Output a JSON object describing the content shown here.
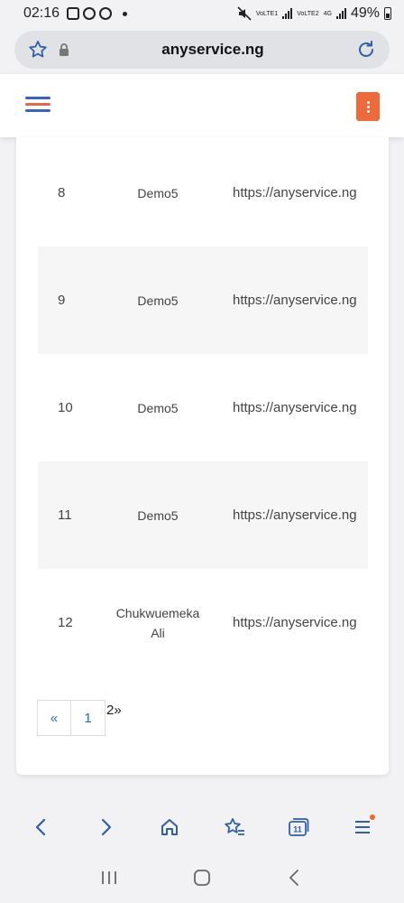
{
  "status_bar": {
    "time": "02:16",
    "sim1_label": "VoLTE1",
    "sim2_label": "VoLTE2",
    "network": "4G",
    "battery": "49%"
  },
  "browser": {
    "url": "anyservice.ng"
  },
  "table": {
    "rows": [
      {
        "num": "8",
        "name": "Demo5",
        "url": "https://anyservice.ng"
      },
      {
        "num": "9",
        "name": "Demo5",
        "url": "https://anyservice.ng"
      },
      {
        "num": "10",
        "name": "Demo5",
        "url": "https://anyservice.ng"
      },
      {
        "num": "11",
        "name": "Demo5",
        "url": "https://anyservice.ng"
      },
      {
        "num": "12",
        "name": "Chukwuemeka Ali",
        "url": "https://anyservice.ng"
      }
    ]
  },
  "pagination": {
    "prev": "«",
    "page1": "1",
    "next": "2»"
  },
  "tabs_count": "11",
  "colors": {
    "accent_orange": "#ee6a3a",
    "link_blue": "#1f6fb5",
    "hamburger_blue": "#3a62c9"
  }
}
